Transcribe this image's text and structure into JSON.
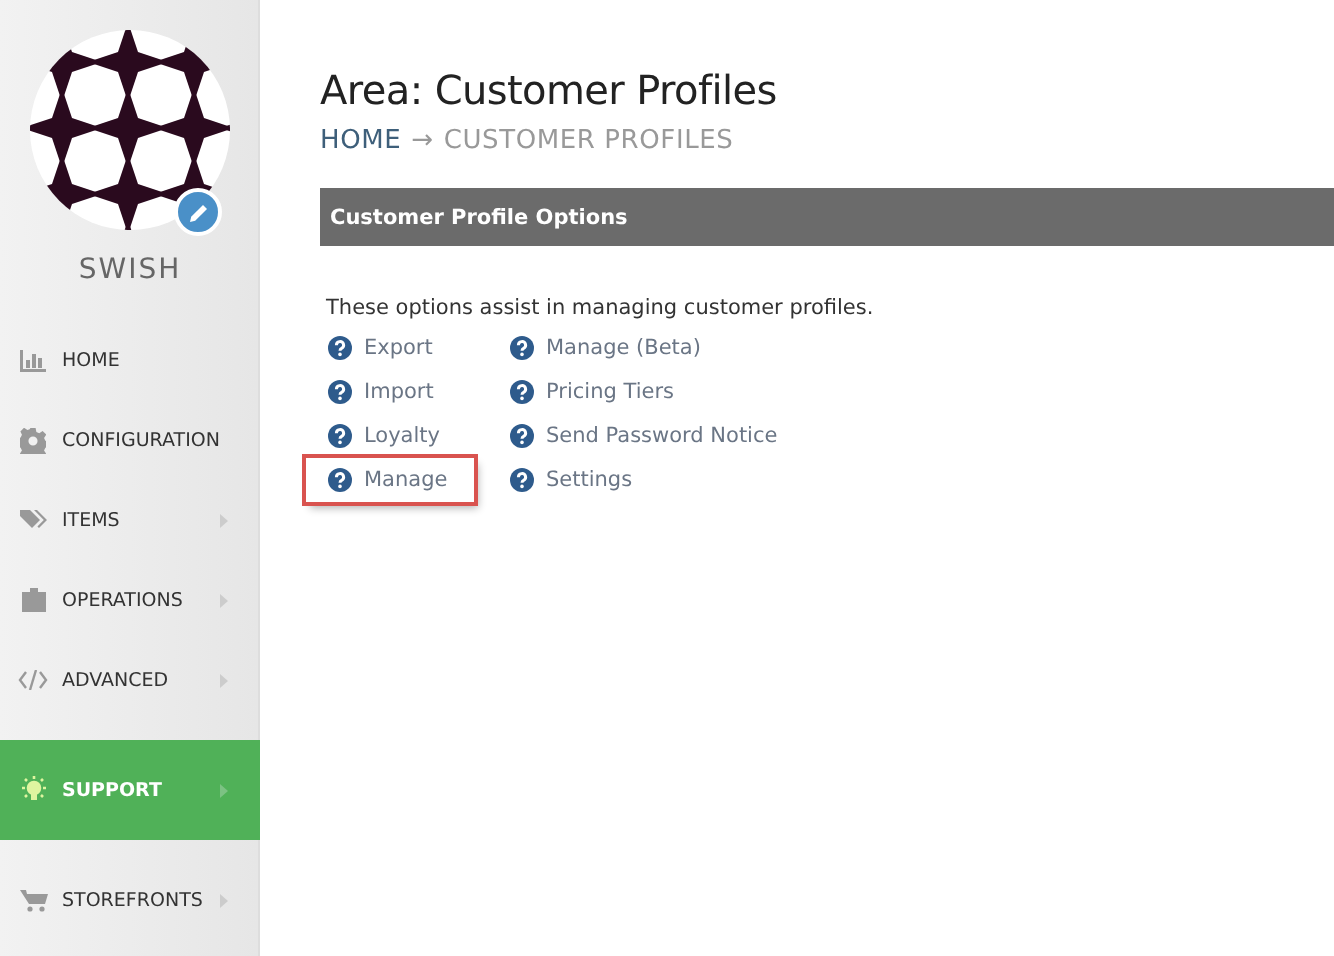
{
  "sidebar": {
    "store_name": "SWISH",
    "items": [
      {
        "label": "HOME",
        "selected": false,
        "has_submenu": false
      },
      {
        "label": "CONFIGURATION",
        "selected": false,
        "has_submenu": false
      },
      {
        "label": "ITEMS",
        "selected": false,
        "has_submenu": true
      },
      {
        "label": "OPERATIONS",
        "selected": false,
        "has_submenu": true
      },
      {
        "label": "ADVANCED",
        "selected": false,
        "has_submenu": true
      },
      {
        "label": "SUPPORT",
        "selected": true,
        "has_submenu": true
      },
      {
        "label": "STOREFRONTS",
        "selected": false,
        "has_submenu": true
      }
    ]
  },
  "page": {
    "title": "Area: Customer Profiles",
    "breadcrumb": [
      {
        "label": "HOME",
        "arrow": "→"
      },
      {
        "label": "CUSTOMER PROFILES"
      }
    ]
  },
  "panel": {
    "header": "Customer Profile Options",
    "description": "These options assist in managing customer profiles.",
    "columns": [
      [
        {
          "label": "Export",
          "highlighted": false
        },
        {
          "label": "Import",
          "highlighted": false
        },
        {
          "label": "Loyalty",
          "highlighted": false
        },
        {
          "label": "Manage",
          "highlighted": true
        }
      ],
      [
        {
          "label": "Manage (Beta)",
          "highlighted": false
        },
        {
          "label": "Pricing Tiers",
          "highlighted": false
        },
        {
          "label": "Send Password Notice",
          "highlighted": false
        },
        {
          "label": "Settings",
          "highlighted": false
        }
      ]
    ]
  }
}
